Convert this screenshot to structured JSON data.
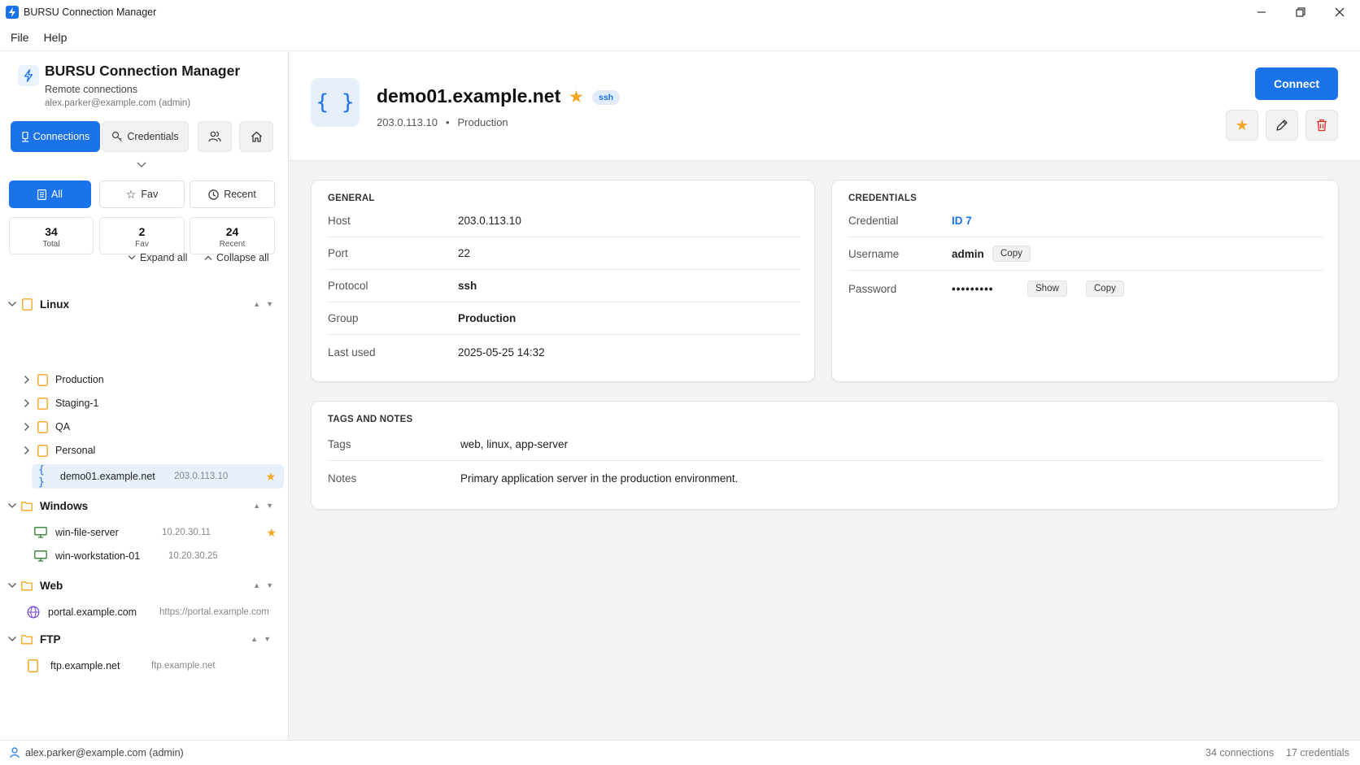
{
  "window": {
    "title": "BURSU Connection Manager"
  },
  "menu": {
    "file": "File",
    "help": "Help"
  },
  "sidebar": {
    "brand_title": "BURSU Connection Manager",
    "brand_subtitle": "Remote connections",
    "brand_user": "alex.parker@example.com (admin)",
    "nav": {
      "connections": "Connections",
      "credentials": "Credentials"
    },
    "filters": {
      "all": "All",
      "fav": "Fav",
      "recent": "Recent"
    },
    "stats": [
      {
        "value": "34",
        "label": "Total"
      },
      {
        "value": "2",
        "label": "Fav"
      },
      {
        "value": "24",
        "label": "Recent"
      }
    ],
    "expand_all": "Expand all",
    "collapse_all": "Collapse all",
    "tree": {
      "linux": {
        "label": "Linux",
        "children": [
          "Production",
          "Staging-1",
          "QA",
          "Personal"
        ]
      },
      "demo": {
        "label": "demo01.example.net",
        "meta": "203.0.113.10"
      },
      "windows": {
        "label": "Windows"
      },
      "win1": {
        "label": "win-file-server",
        "meta": "10.20.30.11"
      },
      "win2": {
        "label": "win-workstation-01",
        "meta": "10.20.30.25"
      },
      "web": {
        "label": "Web"
      },
      "web1": {
        "label": "portal.example.com",
        "meta": "https://portal.example.com"
      },
      "ftp": {
        "label": "FTP"
      },
      "ftp1": {
        "label": "ftp.example.net",
        "meta": "ftp.example.net"
      }
    }
  },
  "detail": {
    "title": "demo01.example.net",
    "badge": "ssh",
    "host_ip": "203.0.113.10",
    "sub_sep": "•",
    "group": "Production",
    "connect_label": "Connect",
    "general": {
      "title": "GENERAL",
      "rows": [
        {
          "key": "Host",
          "value": "203.0.113.10"
        },
        {
          "key": "Port",
          "value": "22"
        },
        {
          "key": "Protocol",
          "value": "ssh"
        },
        {
          "key": "Group",
          "value": "Production"
        },
        {
          "key": "Last used",
          "value": "2025-05-25 14:32"
        }
      ]
    },
    "credentials": {
      "title": "CREDENTIALS",
      "credential_key": "Credential",
      "credential_value": "ID 7",
      "username_key": "Username",
      "username_value": "admin",
      "password_key": "Password",
      "password_value": "•••••••••",
      "copy": "Copy",
      "show": "Show"
    },
    "tags_notes": {
      "title": "TAGS AND NOTES",
      "tags_key": "Tags",
      "tags_value": "web, linux, app-server",
      "notes_key": "Notes",
      "notes_value": "Primary application server in the production environment."
    }
  },
  "status": {
    "user": "alex.parker@example.com (admin)",
    "connections": "34 connections",
    "credentials": "17 credentials"
  },
  "colors": {
    "accent": "#1a73e8",
    "star": "#f5a623",
    "folder": "#f5a623",
    "delete": "#d93025"
  }
}
